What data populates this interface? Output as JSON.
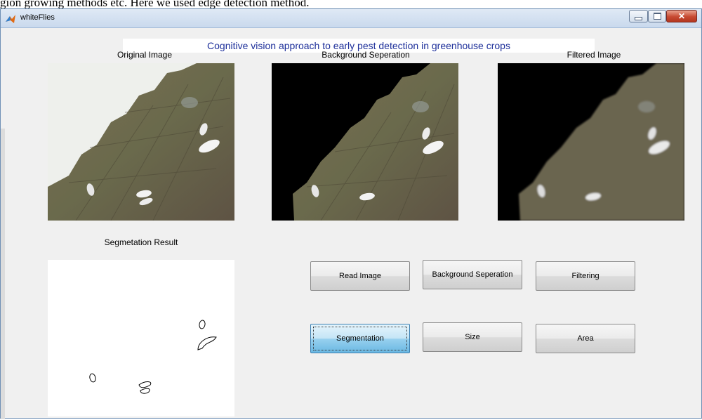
{
  "document": {
    "text": "gion growing methods etc. Here we used edge detection method."
  },
  "window": {
    "title": "whiteFlies",
    "icon": "matlab-icon"
  },
  "app": {
    "banner": "Cognitive vision approach to early pest detection in greenhouse crops",
    "panels": {
      "original_caption": "Original Image",
      "background_caption": "Background Seperation",
      "filtered_caption": "Filtered Image",
      "segmentation_caption": "Segmetation Result"
    },
    "buttons": {
      "read_image": "Read Image",
      "background_seperation": "Background Seperation",
      "filtering": "Filtering",
      "segmentation": "Segmentation",
      "size": "Size",
      "area": "Area"
    },
    "focused_button": "segmentation",
    "colors": {
      "banner_text": "#1d2f9a",
      "leaf": "#6a6a4c",
      "focused_button": "#98d1ef"
    }
  }
}
